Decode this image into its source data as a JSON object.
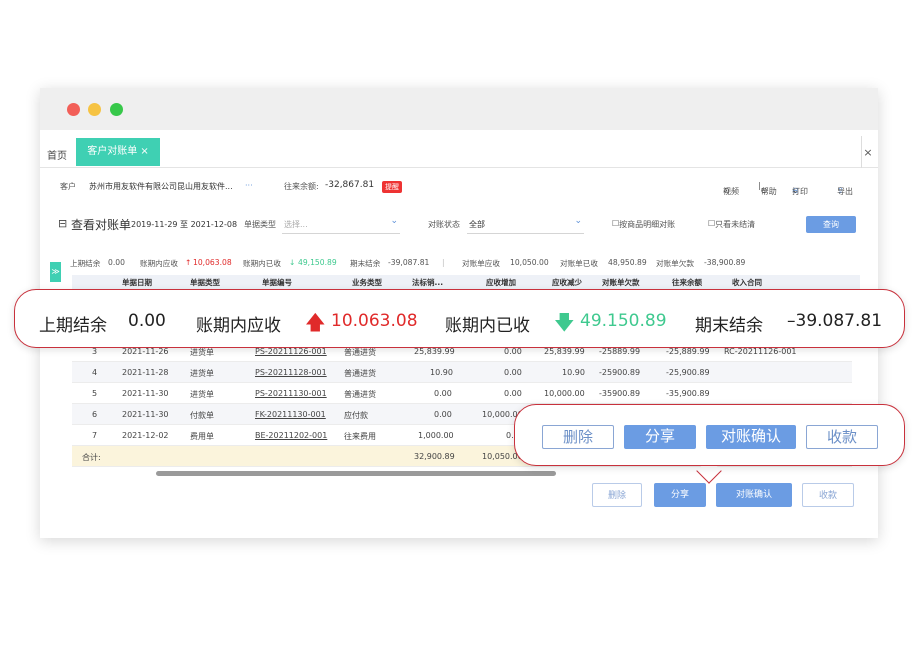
{
  "window": {
    "tabs": {
      "home": "首页",
      "active": "客户对账单",
      "active_close": "×"
    },
    "close": "×"
  },
  "customer": {
    "label": "客户",
    "name": "苏州市用友软件有限公司昆山用友软件...",
    "more": "···",
    "balance_label": "往来余额:",
    "balance_value": "-32,867.81",
    "badge": "提醒",
    "tools": [
      "视频",
      "帮助",
      "打印",
      "导出"
    ]
  },
  "filter": {
    "title": "查看对账单",
    "date_range": "2019-11-29 至 2021-12-08",
    "doc_type_label": "单据类型",
    "doc_type_placeholder": "选择...",
    "status_label": "对账状态",
    "status_value": "全部",
    "check1": "按商品明细对账",
    "check2": "只看未结清",
    "query": "查询"
  },
  "summary": {
    "prev_label": "上期结余",
    "prev_value": "0.00",
    "receivable_label": "账期内应收",
    "receivable_value": "10,063.08",
    "received_label": "账期内已收",
    "received_value": "49,150.89",
    "end_label": "期末结余",
    "end_value": "-39,087.81",
    "bill_recv_label": "对账单应收",
    "bill_recv_value": "10,050.00",
    "bill_got_label": "对账单已收",
    "bill_got_value": "48,950.89",
    "bill_owe_label": "对账单欠款",
    "bill_owe_value": "-38,900.89"
  },
  "table": {
    "headers": [
      "单据日期",
      "单据类型",
      "单据编号",
      "业务类型",
      "法标销...",
      "应收增加",
      "应收减少",
      "对账单欠款",
      "往来余额",
      "收入合同"
    ],
    "rows": [
      [
        "3",
        "2021-11-26",
        "进货单",
        "PS-20211126-001",
        "普通进货",
        "25,839.99",
        "0.00",
        "25,839.99",
        "-25889.99",
        "-25,889.99",
        "RC-20211126-001"
      ],
      [
        "4",
        "2021-11-28",
        "进货单",
        "PS-20211128-001",
        "普通进货",
        "10.90",
        "0.00",
        "10.90",
        "-25900.89",
        "-25,900.89",
        ""
      ],
      [
        "5",
        "2021-11-30",
        "进货单",
        "PS-20211130-001",
        "普通进货",
        "0.00",
        "0.00",
        "10,000.00",
        "-35900.89",
        "-35,900.89",
        ""
      ],
      [
        "6",
        "2021-11-30",
        "付款单",
        "FK-20211130-001",
        "应付款",
        "0.00",
        "10,000.00",
        "",
        "",
        "",
        ""
      ],
      [
        "7",
        "2021-12-02",
        "费用单",
        "BE-20211202-001",
        "往来费用",
        "1,000.00",
        "0.",
        "",
        "",
        "",
        ""
      ]
    ],
    "total_label": "合计:",
    "total_values": [
      "32,900.89",
      "10,050.00"
    ]
  },
  "actions": {
    "delete": "删除",
    "share": "分享",
    "confirm": "对账确认",
    "collect": "收款"
  },
  "zoom_summary": {
    "prev_label": "上期结余",
    "prev_value": "0.00",
    "receivable_label": "账期内应收",
    "receivable_value": "10.063.08",
    "received_label": "账期内已收",
    "received_value": "49.150.89",
    "end_label": "期末结余",
    "end_value": "–39.087.81"
  },
  "colors": {
    "teal": "#3fd0b3",
    "red": "#e02a2a",
    "green": "#3fc98f",
    "blue": "#6b9ce3",
    "callout_border": "#c8313c"
  }
}
